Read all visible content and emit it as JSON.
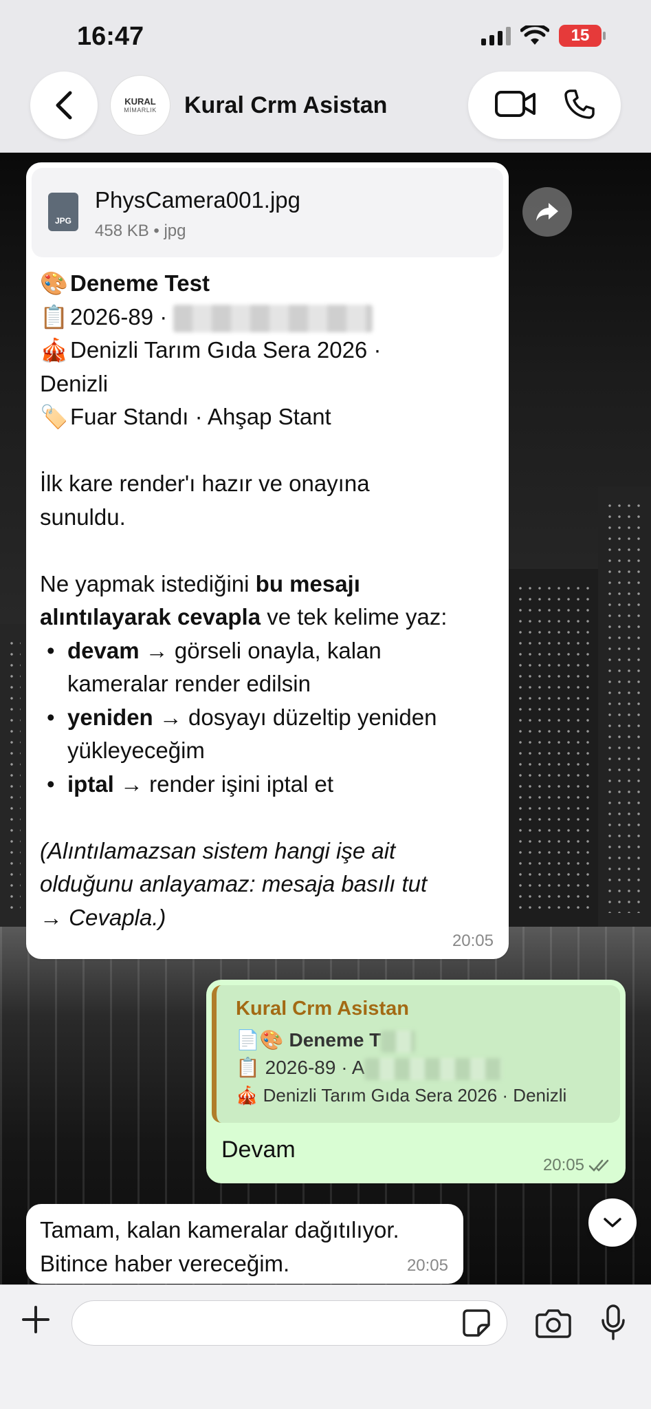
{
  "status_bar": {
    "time": "16:47",
    "battery": "15"
  },
  "header": {
    "contact_name": "Kural Crm Asistan",
    "avatar_text": "KURAL",
    "avatar_subtext": "MİMARLIK"
  },
  "messages": {
    "m1": {
      "file_name": "PhysCamera001.jpg",
      "file_meta": "458 KB • jpg",
      "file_icon_label": "JPG",
      "title_emoji": "🎨",
      "title": "Deneme Test",
      "line2_emoji": "📋",
      "line2_text": "2026-89  ·",
      "line3_emoji": "🎪",
      "line3_text": "Denizli Tarım Gıda Sera 2026 ·",
      "line3b_text": "Denizli",
      "line4_emoji": "🏷️",
      "line4_text": "Fuar Standı · Ahşap Stant",
      "para1_a": "İlk kare render'ı hazır ve onayına",
      "para1_b": "sunuldu.",
      "para2_a_pre": "Ne yapmak istediğini ",
      "para2_a_bold": "bu mesajı",
      "para2_b_bold": "alıntılayarak cevapla",
      "para2_b_post": " ve tek kelime yaz:",
      "bullets": [
        {
          "bold": "devam",
          "rest1": " → görseli onayla, kalan",
          "rest2": "kameralar render edilsin"
        },
        {
          "bold": "yeniden",
          "rest1": " → dosyayı düzeltip yeniden",
          "rest2": "yükleyeceğim"
        },
        {
          "bold": "iptal",
          "rest1": " → render işini iptal et",
          "rest2": ""
        }
      ],
      "note_a": "(Alıntılamazsan sistem hangi işe ait",
      "note_b": "olduğunu anlayamaz: mesaja basılı tut",
      "note_c": "→ Cevapla.)",
      "time": "20:05"
    },
    "m2": {
      "quote_sender": "Kural Crm Asistan",
      "quote_line1_emoji": "📄🎨",
      "quote_line1": "Deneme T",
      "quote_line2_emoji": "📋",
      "quote_line2": "2026-89  ·  A",
      "quote_line3_emoji": "🎪",
      "quote_line3": "Denizli Tarım Gıda Sera 2026 · Denizli",
      "text": "Devam",
      "time": "20:05"
    },
    "m3": {
      "line1": "Tamam, kalan kameralar dağıtılıyor.",
      "line2": "Bitince haber vereceğim.",
      "time": "20:05"
    }
  },
  "composer": {
    "placeholder": ""
  },
  "colors": {
    "outgoing_bubble": "#d9fdd3",
    "quote_sender": "#a36a14",
    "battery": "#e63a3a"
  }
}
